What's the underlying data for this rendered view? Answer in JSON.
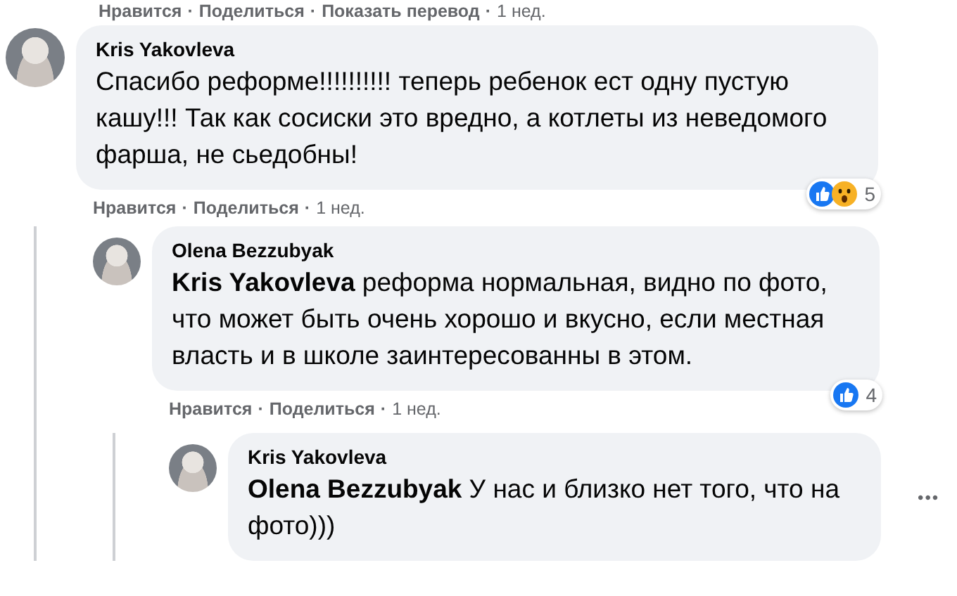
{
  "top_actions": {
    "like": "Нравится",
    "share": "Поделиться",
    "translate": "Показать перевод",
    "time": "1 нед.",
    "separator": "·"
  },
  "comments": [
    {
      "author": "Kris Yakovleva",
      "text": "Спасибо реформе!!!!!!!!!! теперь ребенок ест одну пустую кашу!!! Так как сосиски это вредно, а котлеты из неведомого фарша, не сьедобны!",
      "reactions": [
        {
          "kind": "like"
        },
        {
          "kind": "wow"
        }
      ],
      "reaction_count": "5",
      "actions": {
        "like": "Нравится",
        "share": "Поделиться",
        "time": "1 нед.",
        "separator": "·"
      },
      "children": [
        {
          "author": "Olena Bezzubyak",
          "text": "**Kris Yakovleva** реформа нормальная, видно по фото, что может быть очень хорошо и вкусно, если местная власть и в школе заинтересованны в этом.",
          "reactions": [
            {
              "kind": "like"
            }
          ],
          "reaction_count": "4",
          "actions": {
            "like": "Нравится",
            "share": "Поделиться",
            "time": "1 нед.",
            "separator": "·"
          },
          "children": [
            {
              "author": "Kris Yakovleva",
              "text": "**Olena Bezzubyak** У нас и близко нет того, что на фото)))",
              "more": "•••"
            }
          ]
        }
      ]
    }
  ]
}
